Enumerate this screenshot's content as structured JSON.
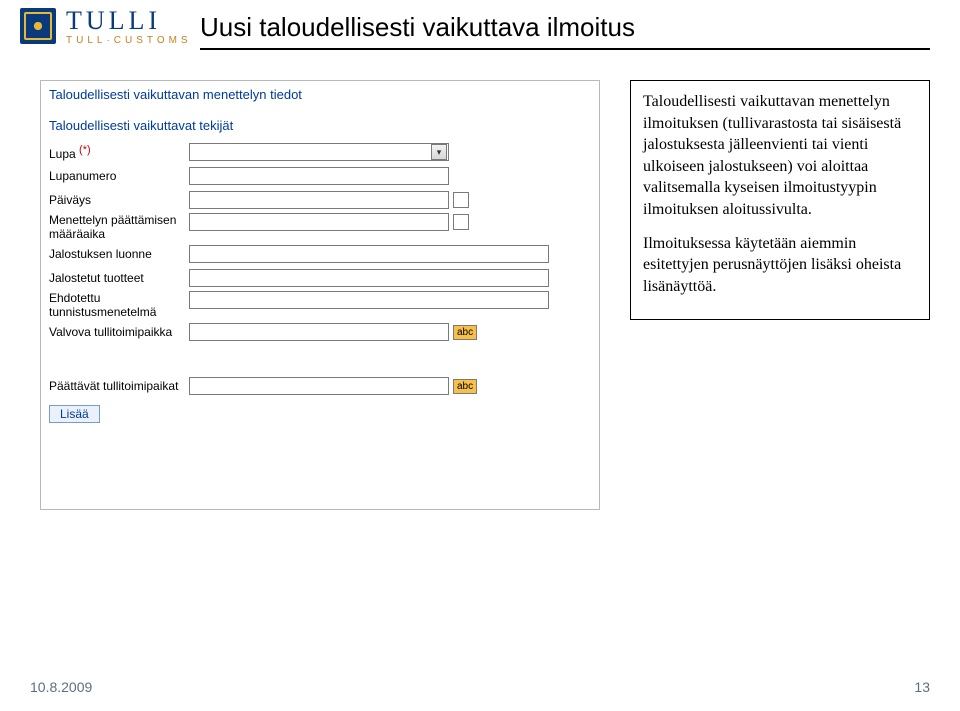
{
  "logo": {
    "main": "TULLI",
    "sub": "TULL·CUSTOMS"
  },
  "title": "Uusi taloudellisesti vaikuttava ilmoitus",
  "form": {
    "legend1": "Taloudellisesti vaikuttavan menettelyn tiedot",
    "legend2": "Taloudellisesti vaikuttavat tekijät",
    "fields": {
      "lupa": "Lupa",
      "lupanumero": "Lupanumero",
      "paivays": "Päiväys",
      "maara_aika_1": "Menettelyn päättämisen",
      "maara_aika_2": "määräaika",
      "jalostuksen_luonne": "Jalostuksen luonne",
      "jalostetut": "Jalostetut tuotteet",
      "ehdotettu1": "Ehdotettu",
      "ehdotettu2": "tunnistusmenetelmä",
      "valvova": "Valvova tullitoimipaikka",
      "paattavat": "Päättävät tullitoimipaikat"
    },
    "required_mark": "(*)",
    "abc": "abc",
    "lisaa": "Lisää"
  },
  "info": {
    "p1": "Taloudellisesti vaikuttavan menettelyn ilmoituksen (tullivarastosta tai sisäisestä jalostuksesta jälleenvienti tai vienti ulkoiseen jalostukseen) voi aloittaa valitsemalla kyseisen ilmoitustyypin ilmoituksen aloitussivulta.",
    "p2": "Ilmoituksessa käytetään aiemmin esitettyjen perusnäyttöjen lisäksi oheista lisänäyttöä."
  },
  "footer": {
    "date": "10.8.2009",
    "page": "13"
  }
}
